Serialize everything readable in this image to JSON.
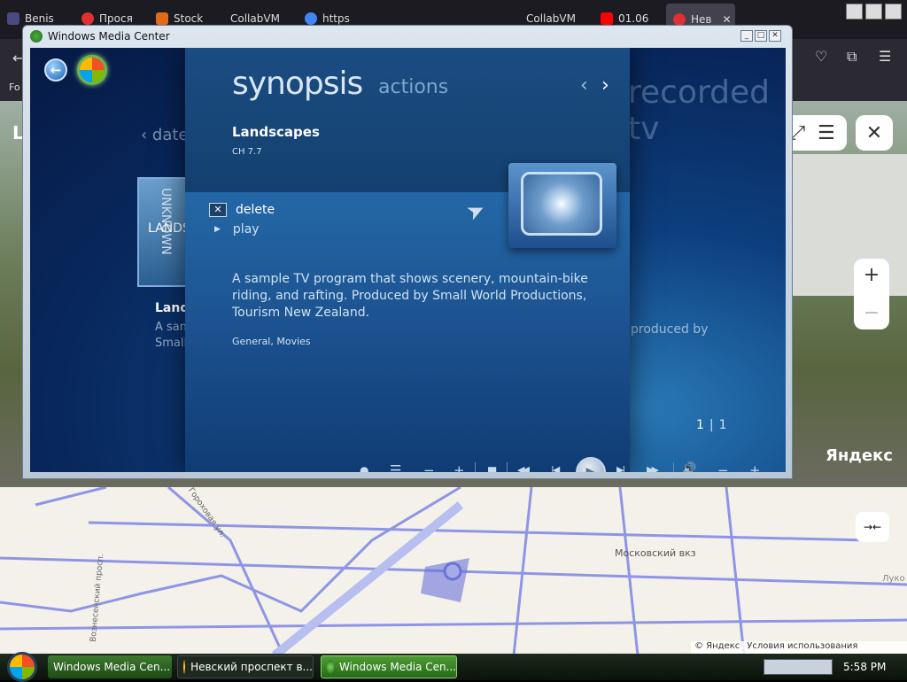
{
  "browser": {
    "tabs": [
      {
        "label": "Benis",
        "color": "#4a4a80"
      },
      {
        "label": "Прося",
        "color": "#e03030"
      },
      {
        "label": "Stock",
        "color": "#e06a1a"
      },
      {
        "label": "CollabVM",
        "color": "#333"
      },
      {
        "label": "https",
        "color": "#4285f4"
      },
      {
        "label": "CollabVM",
        "color": "#333"
      },
      {
        "label": "01.06",
        "color": "#ff0000"
      },
      {
        "label": "Нев",
        "color": "#e03030"
      }
    ],
    "tab_close": "✕",
    "bookmark_fragment": "Fo",
    "page_letter": "L"
  },
  "street": {
    "yandex_label": "Яндекс",
    "zoom_in": "+",
    "zoom_out": "−",
    "close": "✕",
    "menu": "☰",
    "expand": "⤢"
  },
  "map": {
    "station_label": "Московский вкз",
    "street1": "Гороховая ул.",
    "street2": "Вознесенский просп.",
    "right_label": "Луко",
    "copyright": "© Яндекс",
    "terms": "Условия использования",
    "collapse": "→←"
  },
  "wmc": {
    "window_title": "Windows Media Center",
    "bg_section": "recorded tv",
    "bg_sort": "date",
    "bg_item_title": "Landscapes",
    "bg_item_desc1": "A sample TV program...",
    "bg_item_desc2": "Small World Productions",
    "bg_thumb_text": "LANDSCAPES",
    "bg_produced": "produced by",
    "bg_unknown": "UNKNOWN",
    "header_synopsis": "synopsis",
    "header_actions": "actions",
    "program_title": "Landscapes",
    "channel": "CH 7.7",
    "menu": [
      {
        "label": "delete",
        "icon": "x-icon"
      },
      {
        "label": "play",
        "icon": "play-small-icon"
      }
    ],
    "description": "A sample TV program that shows scenery, mountain-bike riding, and rafting. Produced by Small World Productions, Tourism New Zealand.",
    "genres": "General, Movies",
    "page_current": "1",
    "page_sep": "|",
    "page_total": "1",
    "transport": {
      "record": "●",
      "guide": "☰",
      "ch_down": "−",
      "ch_up": "+",
      "stop": "■",
      "rewind": "◀◀",
      "prev": "|◀",
      "play": "▶",
      "next": "▶|",
      "ffwd": "▶▶",
      "mute": "🔊",
      "vol_down": "−",
      "vol_up": "+"
    }
  },
  "taskbar": {
    "start_icon": "windows-orb",
    "items": [
      {
        "label": "Windows Media Cen...",
        "active": false
      },
      {
        "label": "Невский проспект в...",
        "active": false
      },
      {
        "label": "Windows Media Cen...",
        "active": true
      }
    ],
    "time": "5:58 PM"
  }
}
